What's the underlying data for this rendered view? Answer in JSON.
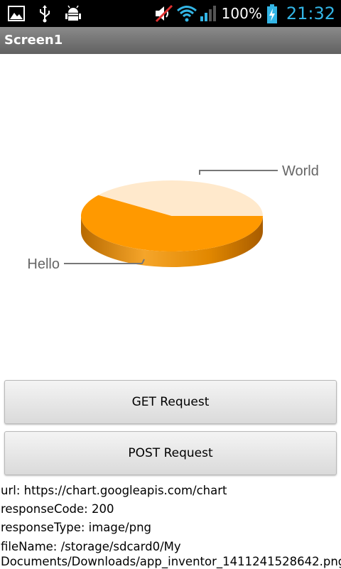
{
  "status_bar": {
    "icons_left": [
      "image-icon",
      "usb-icon",
      "android-debug-icon"
    ],
    "icons_right": [
      "mute-icon",
      "wifi-icon",
      "signal-icon",
      "battery-charging-icon"
    ],
    "battery": "100%",
    "time": "21:32"
  },
  "title_bar": {
    "title": "Screen1"
  },
  "chart_data": {
    "type": "pie",
    "title": "",
    "categories": [
      "Hello",
      "World"
    ],
    "values": [
      60,
      40
    ],
    "colors": [
      "#ff9900",
      "#ffe9cc"
    ],
    "style": "3d"
  },
  "buttons": {
    "get_label": "GET Request",
    "post_label": "POST Request"
  },
  "info": {
    "url_line": "url: https://chart.googleapis.com/chart",
    "response_code_line": "responseCode: 200",
    "response_type_line": "responseType: image/png",
    "file_name_line": "fileName: /storage/sdcard0/My Documents/Downloads/app_inventor_1411241528642.png"
  }
}
